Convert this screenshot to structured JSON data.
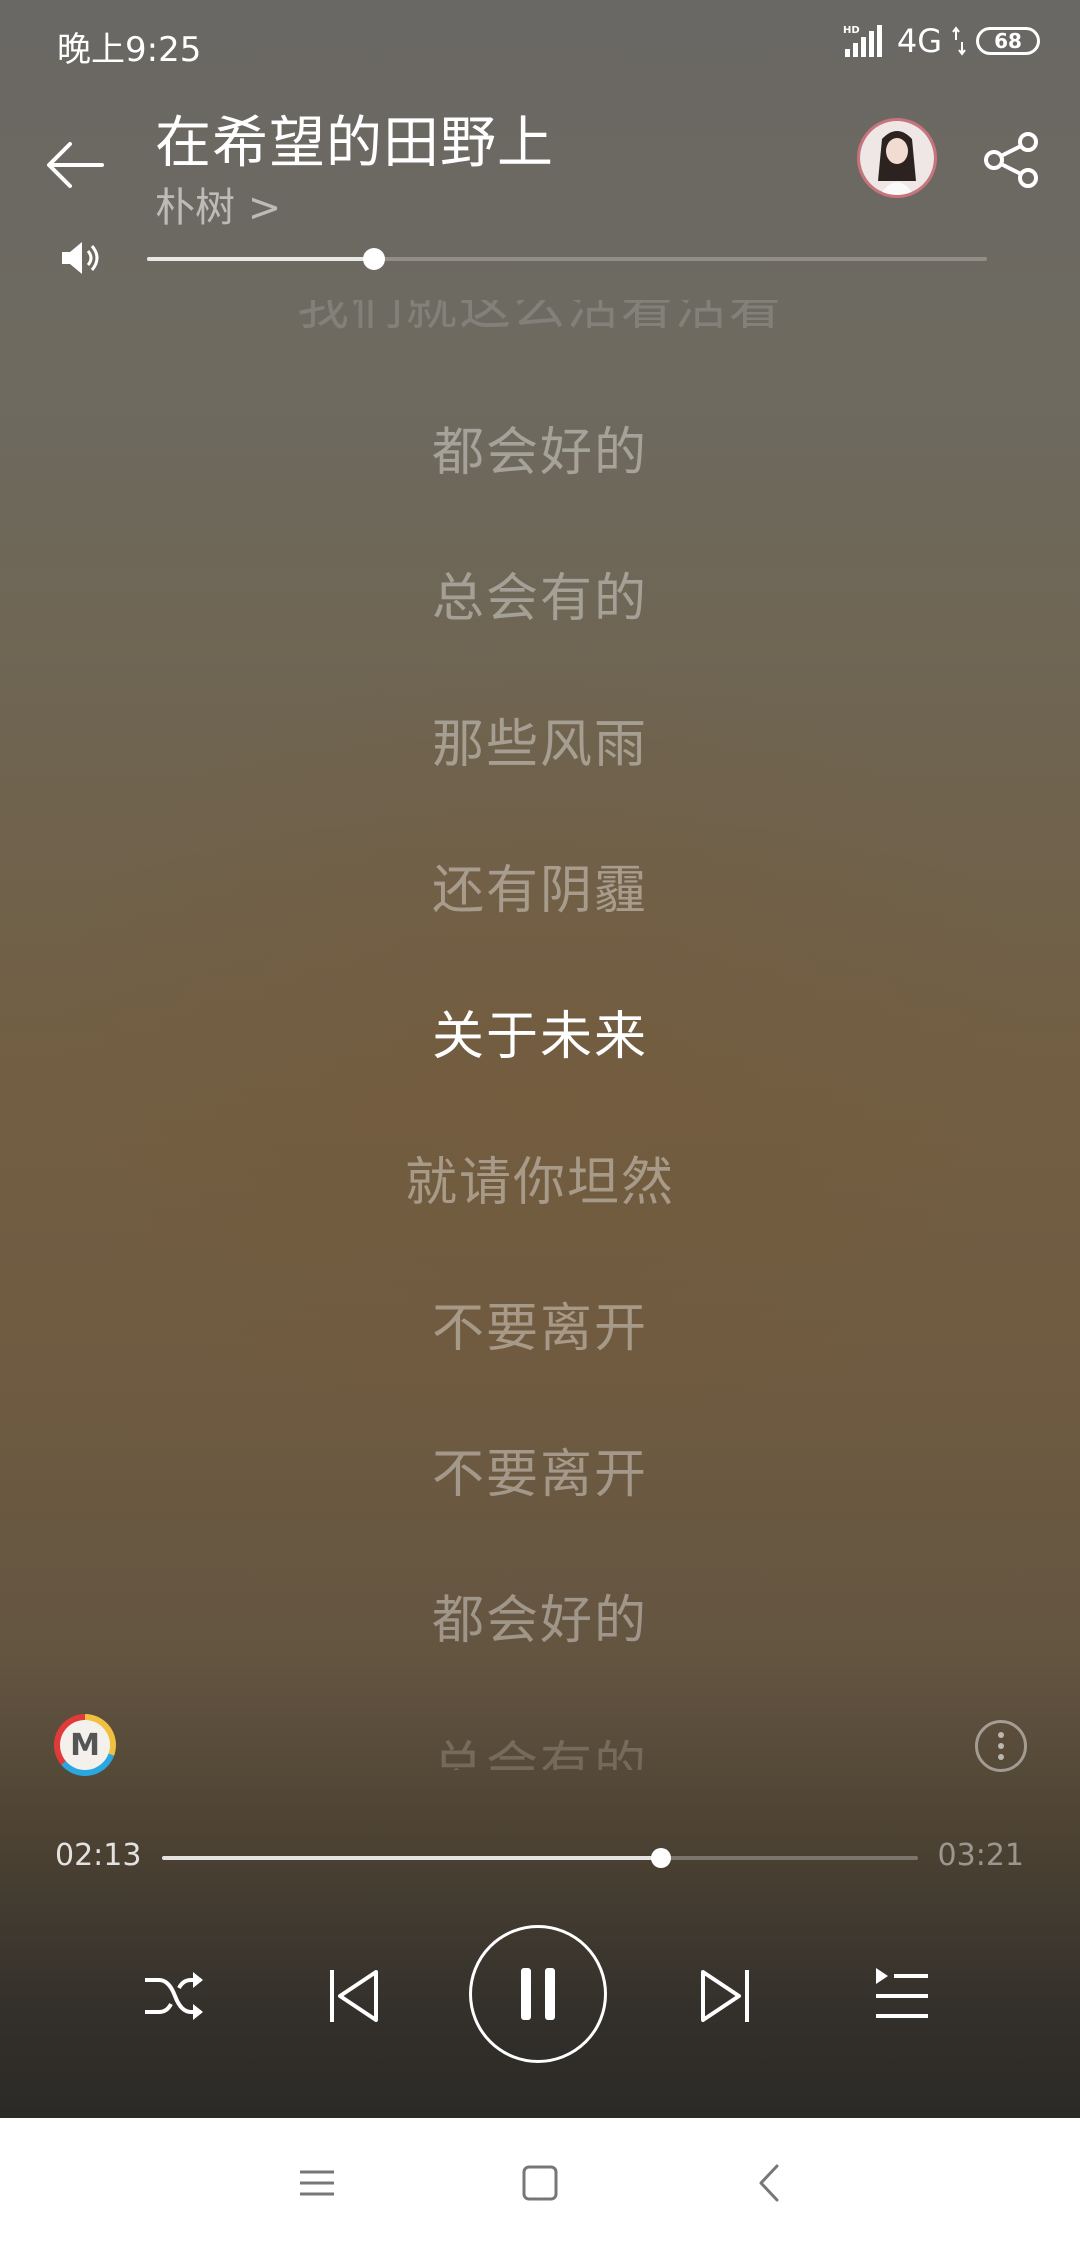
{
  "status_bar": {
    "time": "晚上9:25",
    "signal_label": "HD",
    "network": "4G",
    "battery": "68"
  },
  "header": {
    "song_title": "在希望的田野上",
    "artist": "朴树 >"
  },
  "volume": {
    "level": 0.27
  },
  "lyrics": {
    "lines": [
      {
        "text": "我们就这么活着活着",
        "state": "clipped"
      },
      {
        "text": "都会好的",
        "state": "normal"
      },
      {
        "text": "总会有的",
        "state": "normal"
      },
      {
        "text": "那些风雨",
        "state": "normal"
      },
      {
        "text": "还有阴霾",
        "state": "normal"
      },
      {
        "text": "关于未来",
        "state": "active"
      },
      {
        "text": "就请你坦然",
        "state": "normal"
      },
      {
        "text": "不要离开",
        "state": "normal"
      },
      {
        "text": "不要离开",
        "state": "normal"
      },
      {
        "text": "都会好的",
        "state": "normal"
      },
      {
        "text": "总会有的",
        "state": "faded"
      }
    ]
  },
  "player": {
    "logo_letter": "M",
    "elapsed": "02:13",
    "duration": "03:21",
    "progress": 0.66
  },
  "colors": {
    "accent_logo_yellow": "#f0c040",
    "accent_logo_blue": "#2aa6e0",
    "accent_logo_red": "#e03a3a",
    "avatar_border": "#c9747c"
  }
}
